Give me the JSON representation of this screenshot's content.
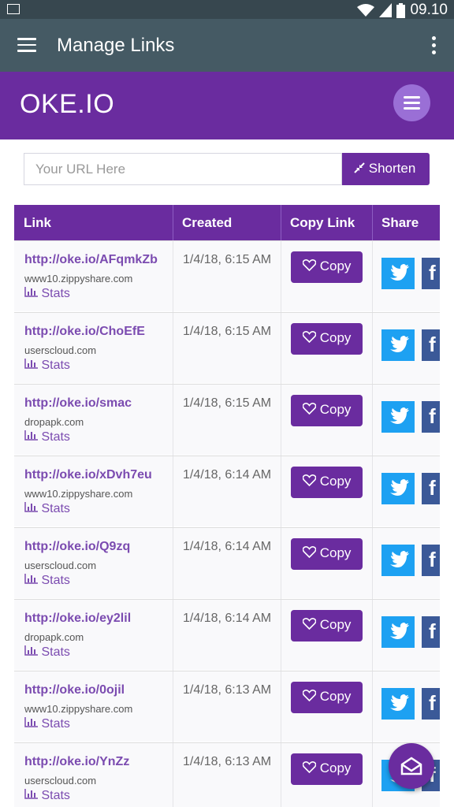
{
  "status_bar": {
    "time": "09.10"
  },
  "app_bar": {
    "title": "Manage Links"
  },
  "brand": {
    "logo": "OKE.IO"
  },
  "url_form": {
    "placeholder": "Your URL Here",
    "shorten_label": "Shorten"
  },
  "table": {
    "headers": [
      "Link",
      "Created",
      "Copy Link",
      "Share"
    ],
    "copy_label": "Copy",
    "stats_label": "Stats",
    "rows": [
      {
        "link": "http://oke.io/AFqmkZb",
        "domain": "www10.zippyshare.com",
        "created": "1/4/18, 6:15 AM"
      },
      {
        "link": "http://oke.io/ChoEfE",
        "domain": "userscloud.com",
        "created": "1/4/18, 6:15 AM"
      },
      {
        "link": "http://oke.io/smac",
        "domain": "dropapk.com",
        "created": "1/4/18, 6:15 AM"
      },
      {
        "link": "http://oke.io/xDvh7eu",
        "domain": "www10.zippyshare.com",
        "created": "1/4/18, 6:14 AM"
      },
      {
        "link": "http://oke.io/Q9zq",
        "domain": "userscloud.com",
        "created": "1/4/18, 6:14 AM"
      },
      {
        "link": "http://oke.io/ey2lil",
        "domain": "dropapk.com",
        "created": "1/4/18, 6:14 AM"
      },
      {
        "link": "http://oke.io/0ojil",
        "domain": "www10.zippyshare.com",
        "created": "1/4/18, 6:13 AM"
      },
      {
        "link": "http://oke.io/YnZz",
        "domain": "userscloud.com",
        "created": "1/4/18, 6:13 AM"
      }
    ]
  },
  "colors": {
    "primary": "#6a2c9f",
    "appbar": "#455a64",
    "twitter": "#1da1f2",
    "facebook": "#3b5998"
  },
  "icons": {
    "menu": "hamburger-icon",
    "more": "kebab-icon",
    "shorten": "compress-icon",
    "copy": "heart-icon",
    "stats": "bar-chart-icon",
    "fab": "envelope-open-icon"
  }
}
